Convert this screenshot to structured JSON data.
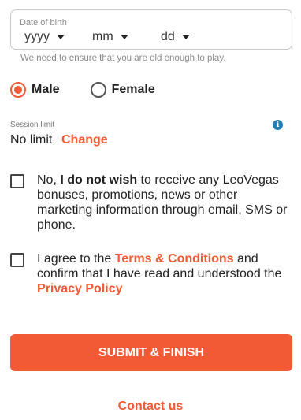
{
  "dob": {
    "label": "Date of birth",
    "year": "yyyy",
    "month": "mm",
    "day": "dd",
    "hint": "We need to ensure that you are old enough to play."
  },
  "gender": {
    "options": [
      {
        "label": "Male",
        "selected": true
      },
      {
        "label": "Female",
        "selected": false
      }
    ]
  },
  "session": {
    "label": "Session limit",
    "value": "No limit",
    "change_label": "Change",
    "info_icon": "info-icon"
  },
  "marketing_optout": {
    "prefix": "No, ",
    "bold": "I do not wish",
    "suffix": " to receive any LeoVegas bonuses, promotions, news or other marketing information through email, SMS or phone.",
    "checked": false
  },
  "terms": {
    "prefix": "I agree to the ",
    "terms_link": "Terms & Conditions",
    "middle": " and confirm that I have read and understood the ",
    "privacy_link": "Privacy Policy",
    "checked": false
  },
  "submit_label": "SUBMIT & FINISH",
  "contact_label": "Contact us",
  "colors": {
    "accent": "#f15a35",
    "info": "#1f7fb8"
  }
}
